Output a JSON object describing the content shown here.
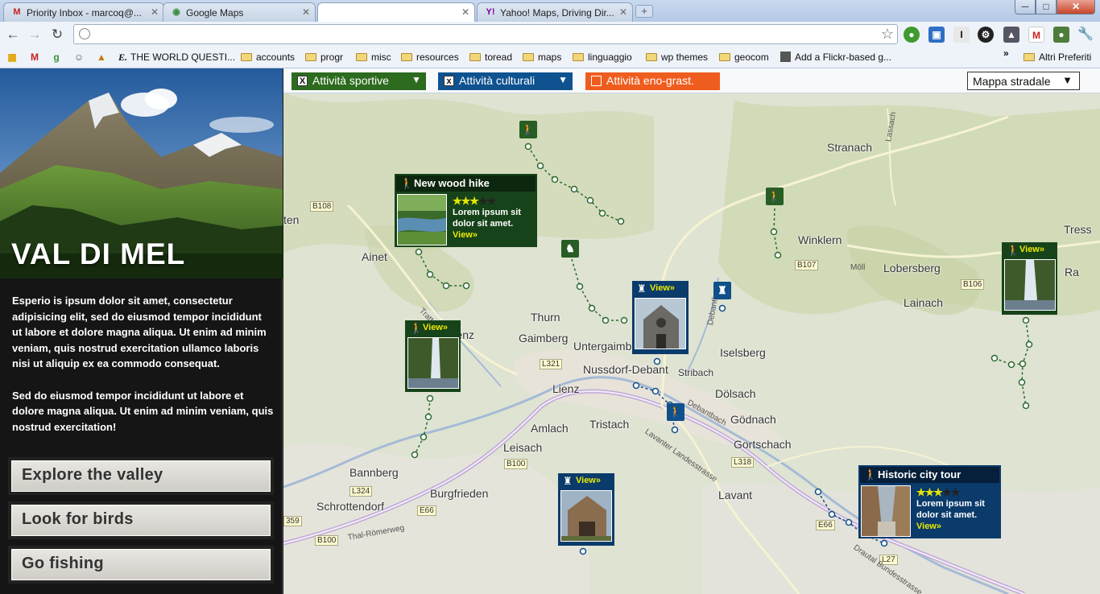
{
  "browser": {
    "tabs": [
      {
        "title": "Priority Inbox - marcoq@...",
        "icon": "gmail-icon"
      },
      {
        "title": "Google Maps",
        "icon": "google-maps-icon"
      },
      {
        "title": "",
        "icon": ""
      },
      {
        "title": "Yahoo! Maps, Driving Dir...",
        "icon": "yahoo-icon"
      }
    ],
    "address_value": "",
    "bookmarks": [
      {
        "label": "THE WORLD QUESTI..."
      },
      {
        "label": "accounts"
      },
      {
        "label": "progr"
      },
      {
        "label": "misc"
      },
      {
        "label": "resources"
      },
      {
        "label": "toread"
      },
      {
        "label": "maps"
      },
      {
        "label": "linguaggio"
      },
      {
        "label": "wp themes"
      },
      {
        "label": "geocom"
      },
      {
        "label": "Add a Flickr-based g..."
      },
      {
        "label": "Altri Preferiti"
      }
    ],
    "overflow_chevron": "»"
  },
  "sidebar": {
    "title": "VAL DI MEL",
    "paragraphs": [
      "Esperio is ipsum dolor sit amet, consectetur adipisicing elit, sed do eiusmod tempor incididunt ut labore et dolore magna aliqua. Ut enim ad minim veniam, quis nostrud exercitation ullamco laboris nisi ut aliquip ex ea commodo consequat.",
      "Sed do eiusmod tempor incididunt ut labore et dolore magna aliqua. Ut enim ad minim veniam, quis nostrud exercitation!"
    ],
    "buttons": [
      "Explore the valley",
      "Look for birds",
      "Go fishing"
    ]
  },
  "filters": [
    {
      "label": "Attività sportive",
      "checked": "X",
      "color": "#2d6b1f"
    },
    {
      "label": "Attività culturali",
      "checked": "x",
      "color": "#0e5290"
    },
    {
      "label": "Attività eno-grast.",
      "checked": "",
      "color": "#ef5d1e"
    }
  ],
  "map_type": {
    "selected": "Mappa stradale"
  },
  "map": {
    "places": [
      "Stranach",
      "Winklern",
      "Lobersberg",
      "Lainach",
      "Tress",
      "Ainet",
      "Thurn",
      "Gaimberg",
      "berlienz",
      "Untergaimb",
      "Nussdorf-Debant",
      "Iselsberg",
      "Stribach",
      "Lienz",
      "Dölsach",
      "Gödnach",
      "Amlach",
      "Tristach",
      "Gortschach",
      "Leisach",
      "Bannberg",
      "Burgfrieden",
      "Schrottendorf",
      "Lavant",
      "ten",
      "Ra"
    ],
    "roads": [
      "B108",
      "B107",
      "B106",
      "L321",
      "B100",
      "L318",
      "L324",
      "E66",
      "B100",
      "E66",
      "L27",
      "359"
    ],
    "streets": [
      "Lassach",
      "Möll",
      "Debantbach",
      "Debantbach",
      "Lavanter Landesstrasse",
      "Thal-Römerweg",
      "Drautal Bundesstrasse",
      "Tratt"
    ],
    "cards": [
      {
        "title": "New wood hike",
        "rating": 3,
        "max": 5,
        "text": "Lorem ipsum sit dolor sit amet.",
        "link": "View»"
      },
      {
        "title": "Historic city tour",
        "rating": 3,
        "max": 5,
        "text": "Lorem ipsum sit dolor sit amet.",
        "link": "View»"
      }
    ],
    "mini_cards": [
      {
        "link": "View»"
      },
      {
        "link": "View»"
      },
      {
        "link": "View»"
      },
      {
        "link": "View»"
      }
    ]
  }
}
